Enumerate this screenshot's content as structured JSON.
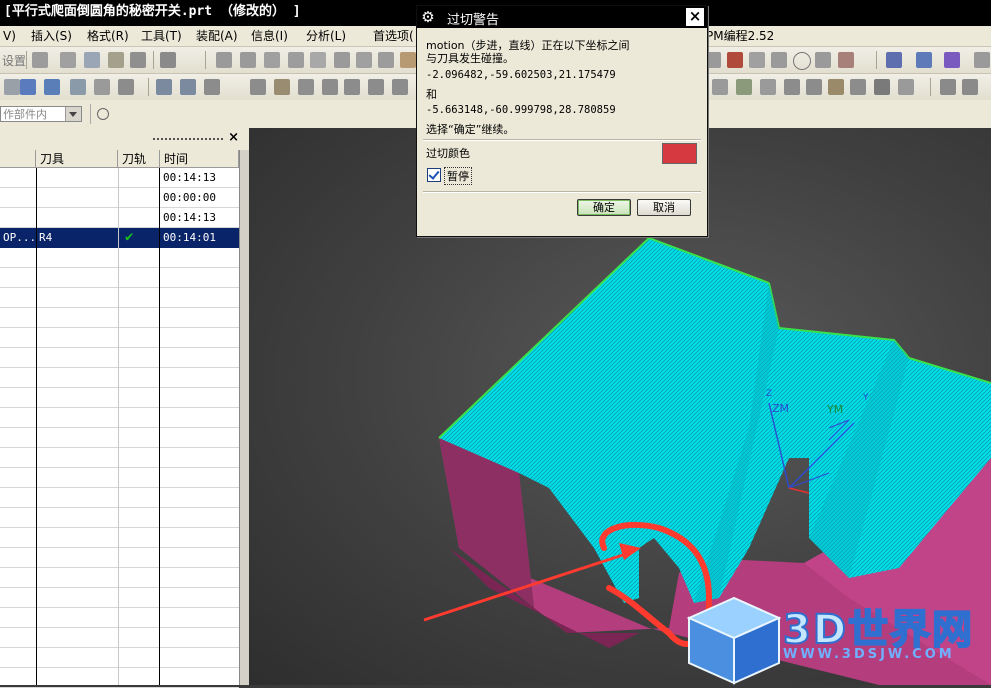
{
  "window": {
    "title": "[平行式爬面倒圆角的秘密开关.prt （修改的） ]"
  },
  "menu": {
    "items": [
      "V)",
      "插入(S)",
      "格式(R)",
      "工具(T)",
      "装配(A)",
      "信息(I)",
      "分析(L)",
      "首选项(",
      "PM编程2.52"
    ]
  },
  "toolbar": {
    "settings_label": "设置"
  },
  "selection": {
    "scope_value": "作部件内"
  },
  "navigator": {
    "columns": [
      "",
      "刀具",
      "刀轨",
      "时间"
    ],
    "rows": [
      {
        "name": "",
        "tool": "",
        "path_ok": false,
        "time": "00:14:13",
        "selected": false
      },
      {
        "name": "",
        "tool": "",
        "path_ok": false,
        "time": "00:00:00",
        "selected": false
      },
      {
        "name": "",
        "tool": "",
        "path_ok": false,
        "time": "00:14:13",
        "selected": false
      },
      {
        "name": "OP...",
        "tool": "R4",
        "path_ok": true,
        "time": "00:14:01",
        "selected": true
      }
    ]
  },
  "dialog": {
    "title": "过切警告",
    "line1": "motion（步进，直线）正在以下坐标之间",
    "line2": "与刀具发生碰撞。",
    "coord1": "-2.096482,-59.602503,21.175479",
    "and": "和",
    "coord2": " -5.663148,-60.999798,28.780859",
    "prompt": "选择“确定”继续。",
    "gouge_color_label": "过切颜色",
    "gouge_color": "#d6393f",
    "pause_label": "暂停",
    "pause_checked": true,
    "ok_label": "确定",
    "cancel_label": "取消"
  },
  "viewport": {
    "axis_z": "ZM",
    "axis_y": "YM",
    "z_tick": "Z",
    "y_tick": "Y",
    "surface_color": "#00e5ee",
    "wall_color": "#b33d7d",
    "annotation_color": "#ff3a2e"
  },
  "watermark": {
    "logo": "3D世界网",
    "url": "WWW.3DSJW.COM"
  }
}
